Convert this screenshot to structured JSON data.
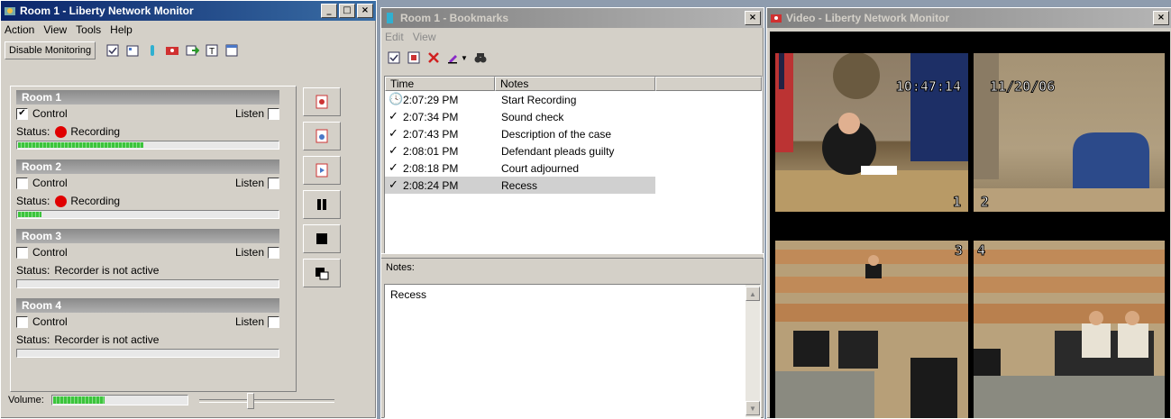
{
  "monitor": {
    "title": "Room 1 - Liberty Network Monitor",
    "menu": [
      "Action",
      "View",
      "Tools",
      "Help"
    ],
    "disable_label": "Disable Monitoring",
    "rooms": [
      {
        "name": "Room 1",
        "control_label": "Control",
        "control_checked": "✔",
        "listen_label": "Listen",
        "status_label": "Status:",
        "status_text": "Recording",
        "level": 0.48
      },
      {
        "name": "Room 2",
        "control_label": "Control",
        "control_checked": "",
        "listen_label": "Listen",
        "status_label": "Status:",
        "status_text": "Recording",
        "level": 0.09
      },
      {
        "name": "Room 3",
        "control_label": "Control",
        "control_checked": "",
        "listen_label": "Listen",
        "status_label": "Status:",
        "status_text": "Recorder is not active",
        "level": 0
      },
      {
        "name": "Room 4",
        "control_label": "Control",
        "control_checked": "",
        "listen_label": "Listen",
        "status_label": "Status:",
        "status_text": "Recorder is not active",
        "level": 0
      }
    ],
    "volume_label": "Volume:",
    "volume_level": 0.38,
    "slider_value": 0.37
  },
  "bookmarks": {
    "title": "Room 1 - Bookmarks",
    "menu": [
      "Edit",
      "View"
    ],
    "columns": [
      "Time",
      "Notes"
    ],
    "rows": [
      {
        "icon": "clock-icon",
        "glyph": "🕓",
        "time": "2:07:29 PM",
        "note": "Start Recording"
      },
      {
        "icon": "check-icon",
        "glyph": "✓",
        "time": "2:07:34 PM",
        "note": "Sound check"
      },
      {
        "icon": "check-icon",
        "glyph": "✓",
        "time": "2:07:43 PM",
        "note": "Description of the case"
      },
      {
        "icon": "check-icon",
        "glyph": "✓",
        "time": "2:08:01 PM",
        "note": "Defendant pleads guilty"
      },
      {
        "icon": "check-icon",
        "glyph": "✓",
        "time": "2:08:18 PM",
        "note": "Court adjourned"
      },
      {
        "icon": "check-icon",
        "glyph": "✓",
        "time": "2:08:24 PM",
        "note": "Recess"
      }
    ],
    "selected_index": 5,
    "notes_label": "Notes:",
    "notes_text": "Recess"
  },
  "video": {
    "title": "Video - Liberty Network Monitor",
    "cams": [
      {
        "label": "1",
        "overlay": "10:47:14"
      },
      {
        "label": "2",
        "overlay": "11/20/06"
      },
      {
        "label": "3",
        "overlay": ""
      },
      {
        "label": "4",
        "overlay": ""
      }
    ]
  },
  "colors": {
    "recording": "#e00000",
    "level_green": "#3cc43c",
    "title_active": "#0a246a"
  }
}
